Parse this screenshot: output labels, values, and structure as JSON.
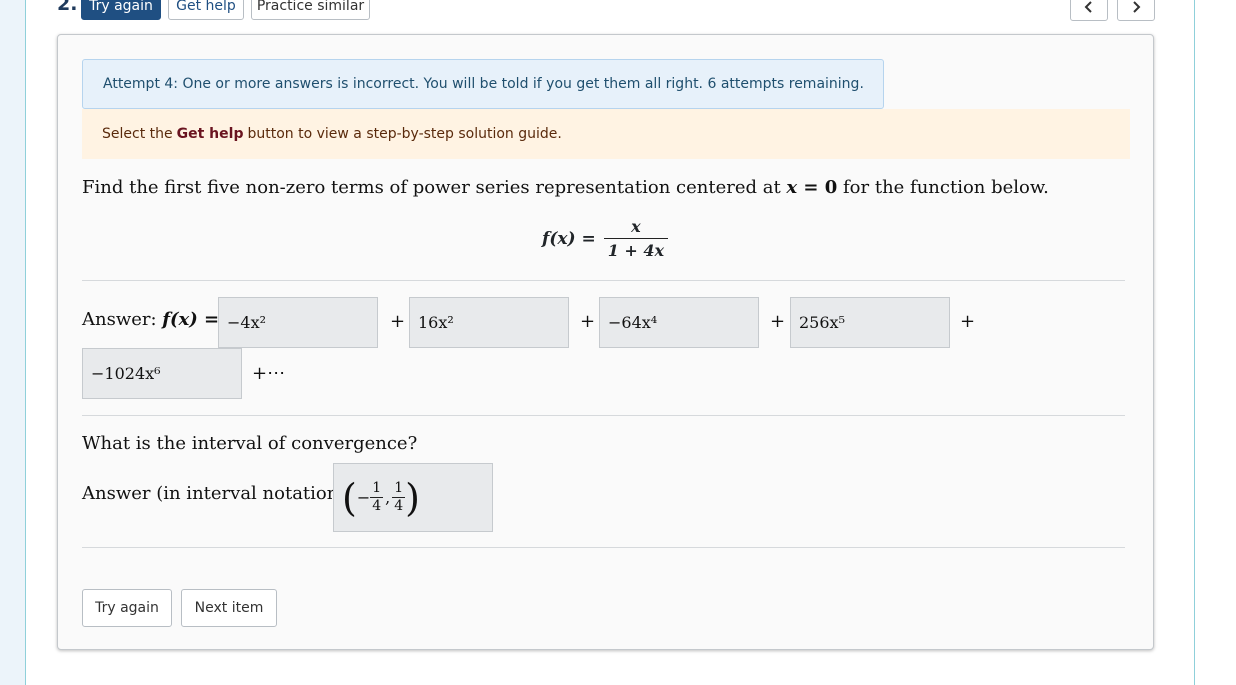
{
  "header": {
    "question_number": "2.",
    "buttons": {
      "try_again": "Try again",
      "get_help": "Get help",
      "practice_similar": "Practice similar"
    },
    "nav": {
      "prev": "<",
      "next": ">"
    }
  },
  "alerts": {
    "attempt": "Attempt 4: One or more answers is incorrect. You will be told if you get them all right. 6 attempts remaining.",
    "help_prefix": "Select the ",
    "help_bold": "Get help",
    "help_suffix": " button to view a step-by-step solution guide."
  },
  "question": {
    "prefix": "Find the first five non-zero terms of power series representation centered at ",
    "var": "x",
    "equals_zero": " = 0",
    "suffix": " for the function below.",
    "function_lhs": "f(x) =",
    "numerator": "x",
    "denominator": "1 + 4x"
  },
  "answer": {
    "label_prefix": "Answer: ",
    "label_math": "f(x) =",
    "terms": [
      "−4x²",
      "16x²",
      "−64x⁴",
      "256x⁵",
      "−1024x⁶"
    ],
    "plus": "+",
    "ellipsis": "+⋯"
  },
  "interval": {
    "question": "What is the interval of convergence?",
    "label": "Answer (in interval notation):",
    "left_paren": "(",
    "minus": "−",
    "a_num": "1",
    "a_den": "4",
    "comma": ",",
    "b_num": "1",
    "b_den": "4",
    "right_paren": ")"
  },
  "footer": {
    "try_again": "Try again",
    "next_item": "Next item"
  }
}
